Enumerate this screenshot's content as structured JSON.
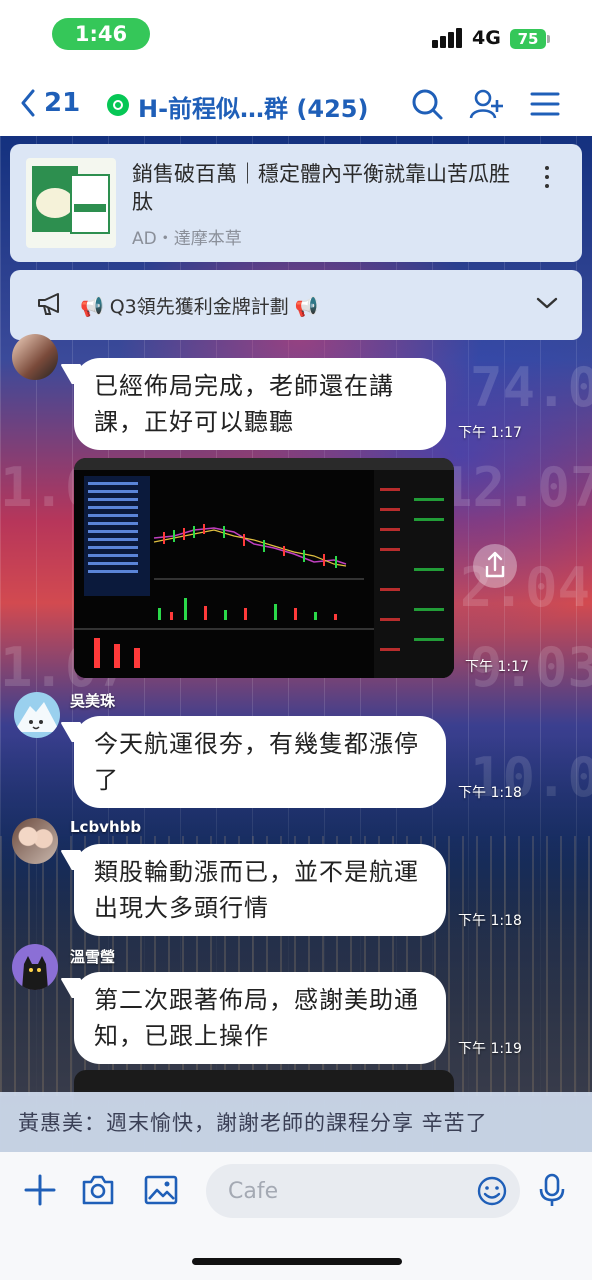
{
  "status_bar": {
    "time": "1:46",
    "network": "4G",
    "battery": "75"
  },
  "header": {
    "back_count": "21",
    "title": "H-前程似…群 (425)"
  },
  "ad": {
    "title": "銷售破百萬｜穩定體內平衡就靠山苦瓜胜肽",
    "meta": "AD・達摩本草"
  },
  "announcement": {
    "text": "📢 Q3領先獲利金牌計劃 📢"
  },
  "messages": [
    {
      "sender": "",
      "text": "已經佈局完成，老師還在講課，正好可以聽聽",
      "time": "下午 1:17"
    },
    {
      "type": "image",
      "time": "下午 1:17"
    },
    {
      "sender": "吳美珠",
      "text": "今天航運很夯，有幾隻都漲停了",
      "time": "下午 1:18"
    },
    {
      "sender": "Lcbvhbb",
      "text": "類股輪動漲而已，並不是航運出現大多頭行情",
      "time": "下午 1:18"
    },
    {
      "sender": "溫雪瑩",
      "text": "第二次跟著佈局，感謝美助通知，已跟上操作",
      "time": "下午 1:19"
    }
  ],
  "pinned_preview": "黃惠美：週末愉快，謝謝老師的課程分享 辛苦了",
  "input": {
    "placeholder": "Cafe"
  },
  "colors": {
    "accent": "#1f5fb8",
    "line_green": "#06c755",
    "status_green": "#35c759"
  }
}
